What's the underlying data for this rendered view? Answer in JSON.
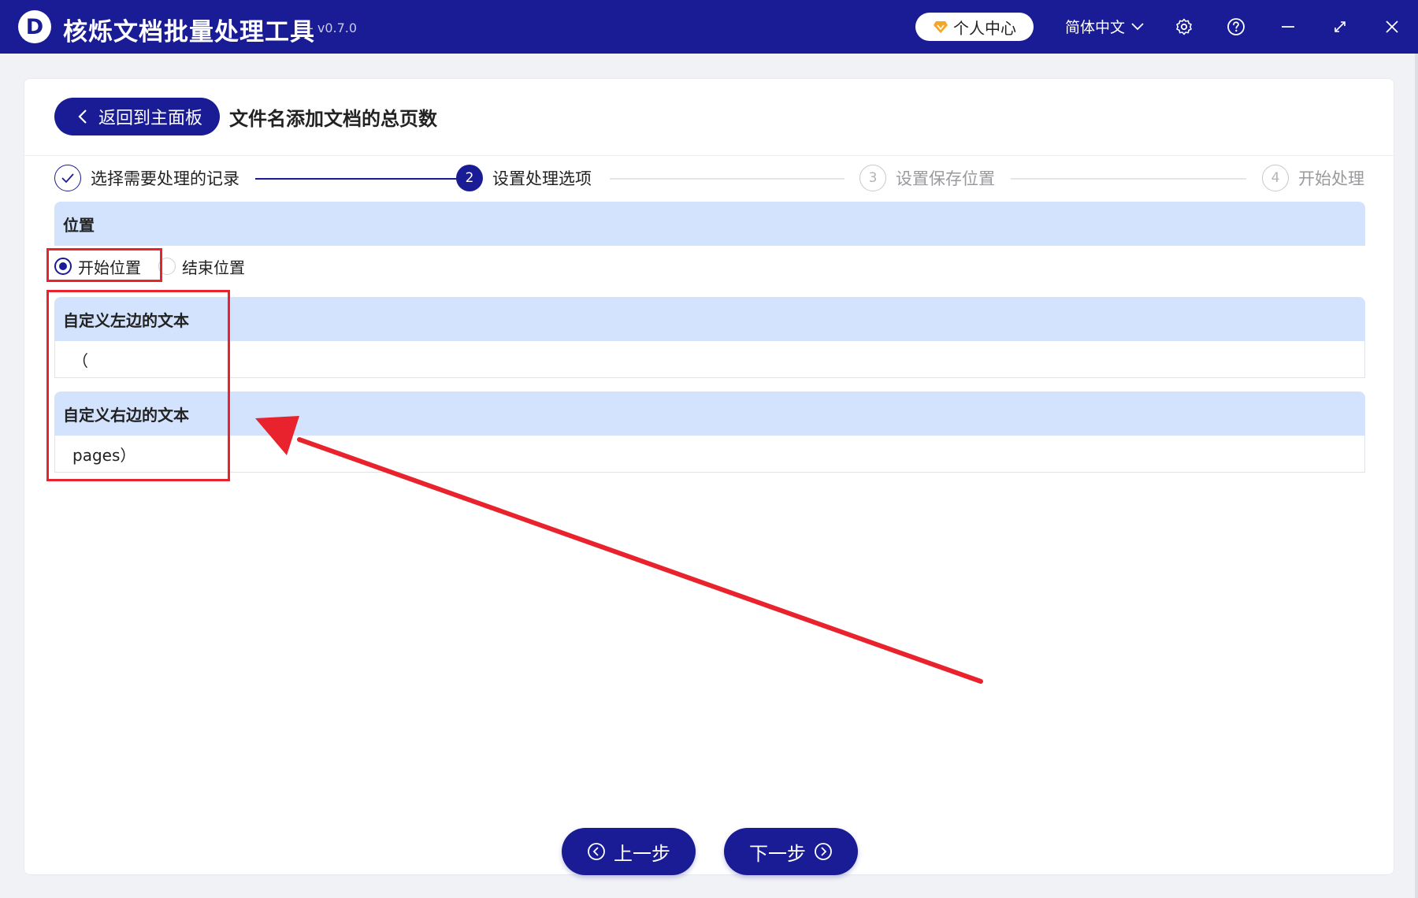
{
  "app": {
    "title": "核烁文档批量处理工具",
    "version": "- v0.7.0",
    "logo_letter": "D",
    "user_center": "个人中心",
    "language": "简体中文",
    "colors": {
      "brand": "#1a1c96",
      "section_bg": "#d3e3fd",
      "annotation": "#e8232d",
      "diamond": "#f5a623"
    }
  },
  "header": {
    "back_label": "返回到主面板",
    "page_title": "文件名添加文档的总页数"
  },
  "steps": [
    {
      "num": "✓",
      "label": "选择需要处理的记录",
      "state": "done"
    },
    {
      "num": "2",
      "label": "设置处理选项",
      "state": "active"
    },
    {
      "num": "3",
      "label": "设置保存位置",
      "state": "todo"
    },
    {
      "num": "4",
      "label": "开始处理",
      "state": "todo"
    }
  ],
  "position": {
    "heading": "位置",
    "options": [
      {
        "label": "开始位置",
        "checked": true
      },
      {
        "label": "结束位置",
        "checked": false
      }
    ]
  },
  "left_text": {
    "heading": "自定义左边的文本",
    "value": "（"
  },
  "right_text": {
    "heading": "自定义右边的文本",
    "value": "pages）"
  },
  "nav": {
    "prev_label": "上一步",
    "next_label": "下一步"
  }
}
